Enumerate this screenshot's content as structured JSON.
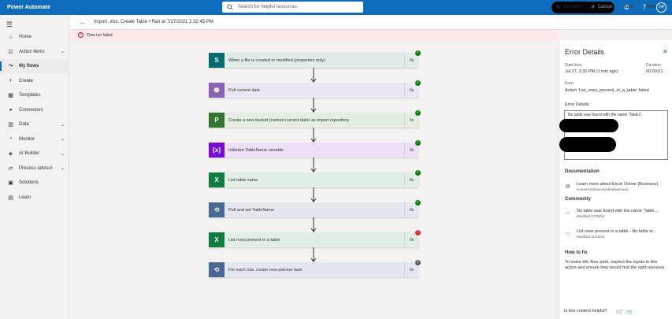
{
  "app": {
    "title": "Power Automate"
  },
  "search": {
    "placeholder": "Search for helpful resources"
  },
  "user": {
    "initials": "JW"
  },
  "icons": {
    "search": "search-icon",
    "settings": "gear-icon",
    "help": "help-icon",
    "back": "arrow-left-icon",
    "close": "close-icon"
  },
  "sidebar": {
    "items": [
      {
        "label": "Home",
        "icon": "home-icon",
        "chevron": false,
        "active": false
      },
      {
        "label": "Action items",
        "icon": "checklist-icon",
        "chevron": true,
        "active": false
      },
      {
        "label": "My flows",
        "icon": "flow-icon",
        "chevron": false,
        "active": true
      },
      {
        "label": "Create",
        "icon": "plus-icon",
        "chevron": false,
        "active": false
      },
      {
        "label": "Templates",
        "icon": "template-icon",
        "chevron": false,
        "active": false
      },
      {
        "label": "Connectors",
        "icon": "connector-icon",
        "chevron": false,
        "active": false
      },
      {
        "label": "Data",
        "icon": "database-icon",
        "chevron": true,
        "active": false
      },
      {
        "label": "Monitor",
        "icon": "monitor-icon",
        "chevron": true,
        "active": false
      },
      {
        "label": "AI Builder",
        "icon": "ai-icon",
        "chevron": true,
        "active": false
      },
      {
        "label": "Process advisor",
        "icon": "process-icon",
        "chevron": true,
        "active": false
      },
      {
        "label": "Solutions",
        "icon": "solutions-icon",
        "chevron": false,
        "active": false
      },
      {
        "label": "Learn",
        "icon": "book-icon",
        "chevron": false,
        "active": false
      }
    ]
  },
  "header": {
    "breadcrumb": "Import .xlsx, Create Table • Ran at 7/27/2021 2:32:45 PM",
    "resubmit": "Resubmit",
    "cancel": "Cancel",
    "edit": "Edit",
    "help": "Help"
  },
  "error_banner": {
    "text": "Flow run failed."
  },
  "flow": {
    "steps": [
      {
        "label": "When a file is created or modified (properties only)",
        "duration": "0s",
        "status": "ok",
        "icon_color": "#036c70",
        "bg": "#e1ecea",
        "glyph": "S"
      },
      {
        "label": "Pull current date",
        "duration": "0s",
        "status": "ok",
        "icon_color": "#8764b8",
        "bg": "#ece6f4",
        "glyph": "⌚"
      },
      {
        "label": "Create a new bucket (named current date) as import repository",
        "duration": "0s",
        "status": "ok",
        "icon_color": "#31752f",
        "bg": "#e3eee1",
        "glyph": "P"
      },
      {
        "label": "Initialize TableName variable",
        "duration": "0s",
        "status": "ok",
        "icon_color": "#770bd6",
        "bg": "#ecdff8",
        "glyph": "{x}"
      },
      {
        "label": "List table name",
        "duration": "0s",
        "status": "ok",
        "icon_color": "#107c41",
        "bg": "#e1eee4",
        "glyph": "X"
      },
      {
        "label": "Pull and set TableName",
        "duration": "0s",
        "status": "ok",
        "icon_color": "#486991",
        "bg": "#e4e8ee",
        "glyph": "⟲"
      },
      {
        "label": "List rows present in a table",
        "duration": "0s",
        "status": "fail",
        "icon_color": "#107c41",
        "bg": "#e1eee4",
        "glyph": "X"
      },
      {
        "label": "For each row, create new planner task",
        "duration": "0s",
        "status": "skip",
        "icon_color": "#486991",
        "bg": "#e4e8ee",
        "glyph": "⟲"
      }
    ]
  },
  "panel": {
    "title": "Error Details",
    "start_time_label": "Start time",
    "start_time": "Jul 27, 2:32 PM (1 min ago)",
    "duration_label": "Duration",
    "duration": "00:00:01",
    "error_label": "Error",
    "error_text": "Action 'List_rows_present_in_a_table' failed",
    "error_details_label": "Error Details",
    "error_details": "No table was found with the name 'Table1'.",
    "documentation_heading": "Documentation",
    "doc_link_title": "Learn more about Excel Online (Business)",
    "doc_link_sub": "/connectors/excelonlinebusiness/",
    "community_heading": "Community",
    "community": [
      {
        "title": "No table was found with the name 'Table...",
        "sub": "Modified 07/08/21"
      },
      {
        "title": "List rows present in a table - No table w...",
        "sub": "Modified 11/25/20"
      }
    ],
    "how_to_fix_heading": "How to fix",
    "how_to_fix": "To make this flow work, inspect the inputs to this action and ensure they would find the right resource.",
    "helpful": "Is this content helpful?"
  }
}
